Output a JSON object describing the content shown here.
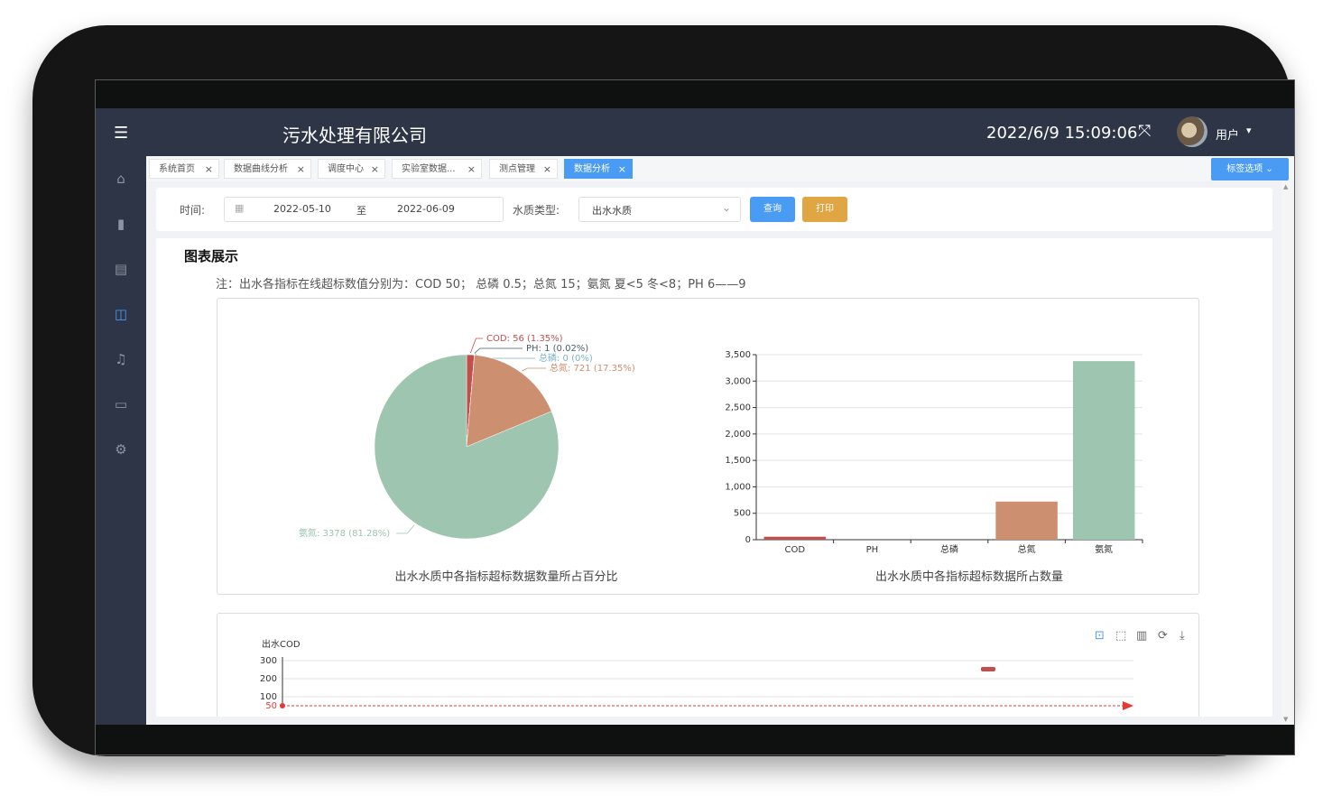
{
  "header": {
    "app_title": "污水处理有限公司",
    "datetime": "2022/6/9 15:09:06",
    "user_label": "用户"
  },
  "sidebar": {
    "items": [
      {
        "icon": "home-icon"
      },
      {
        "icon": "bar-chart-icon"
      },
      {
        "icon": "document-icon"
      },
      {
        "icon": "presentation-icon",
        "active": true
      },
      {
        "icon": "bell-icon"
      },
      {
        "icon": "archive-icon"
      },
      {
        "icon": "gear-icon"
      }
    ]
  },
  "tabs": {
    "items": [
      {
        "label": "系统首页"
      },
      {
        "label": "数据曲线分析"
      },
      {
        "label": "调度中心"
      },
      {
        "label": "实验室数据..."
      },
      {
        "label": "测点管理"
      },
      {
        "label": "数据分析",
        "active": true
      }
    ],
    "options_label": "标签选项"
  },
  "filter": {
    "time_label": "时间:",
    "date_start": "2022-05-10",
    "date_sep": "至",
    "date_end": "2022-06-09",
    "type_label": "水质类型:",
    "type_value": "出水水质",
    "query_label": "查询",
    "print_label": "打印"
  },
  "section": {
    "title": "图表展示",
    "note": "注：出水各指标在线超标数值分别为：COD 50； 总磷 0.5；总氮 15；氨氮 夏<5 冬<8；PH 6——9"
  },
  "colors": {
    "accent": "#4a9bf4",
    "print": "#e0a644",
    "cod": "#c0504d",
    "ph": "#4a5f6e",
    "tp": "#7fb3c8",
    "tn": "#cc8f70",
    "nh": "#9dc5b0"
  },
  "chart_data": [
    {
      "type": "pie",
      "title": "出水水质中各指标超标数据数量所占百分比",
      "slices": [
        {
          "label": "COD: 56 (1.35%)",
          "name": "COD",
          "value": 56
        },
        {
          "label": "PH: 1 (0.02%)",
          "name": "PH",
          "value": 1
        },
        {
          "label": "总磷: 0 (0%)",
          "name": "总磷",
          "value": 0
        },
        {
          "label": "总氮: 721 (17.35%)",
          "name": "总氮",
          "value": 721
        },
        {
          "label": "氨氮: 3378 (81.28%)",
          "name": "氨氮",
          "value": 3378
        }
      ]
    },
    {
      "type": "bar",
      "title": "出水水质中各指标超标数据所占数量",
      "categories": [
        "COD",
        "PH",
        "总磷",
        "总氮",
        "氨氮"
      ],
      "values": [
        56,
        1,
        0,
        721,
        3378
      ],
      "ylim": [
        0,
        3500
      ],
      "yticks": [
        "0",
        "500",
        "1,000",
        "1,500",
        "2,000",
        "2,500",
        "3,000",
        "3,500"
      ],
      "grid": true
    },
    {
      "type": "line",
      "ylabel": "出水COD",
      "yticks": [
        "300",
        "200",
        "100"
      ],
      "threshold_label": "50",
      "ylim": [
        50,
        300
      ],
      "toolbox": [
        "zoom-icon",
        "zoom-reset-icon",
        "bar-toggle-icon",
        "restore-icon",
        "download-icon"
      ]
    }
  ]
}
